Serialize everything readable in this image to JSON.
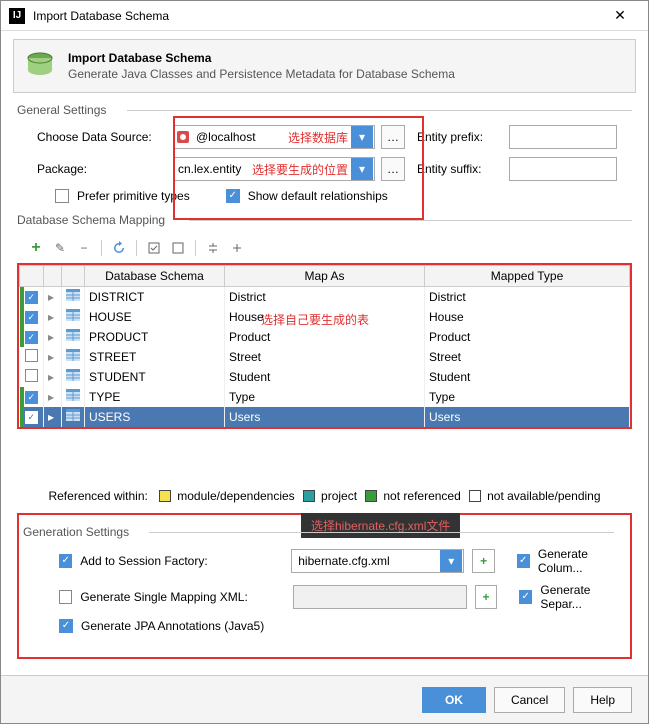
{
  "window": {
    "title": "Import Database Schema"
  },
  "banner": {
    "title": "Import Database Schema",
    "subtitle": "Generate Java Classes and Persistence Metadata for Database Schema"
  },
  "sections": {
    "general": "General Settings",
    "dbmap": "Database Schema Mapping",
    "gen": "Generation Settings"
  },
  "general": {
    "data_source_label": "Choose Data Source:",
    "data_source_value": "@localhost",
    "data_source_ann": "选择数据库",
    "package_label": "Package:",
    "package_value": "cn.lex.entity",
    "package_ann": "选择要生成的位置",
    "entity_prefix_label": "Entity prefix:",
    "entity_prefix_value": "",
    "entity_suffix_label": "Entity suffix:",
    "entity_suffix_value": "",
    "prefer_primitive": "Prefer primitive types",
    "show_default_rel": "Show default relationships"
  },
  "table": {
    "headers": {
      "schema": "Database Schema",
      "map": "Map As",
      "type": "Mapped Type"
    },
    "annotation": "选择自己要生成的表",
    "rows": [
      {
        "checked": true,
        "green": true,
        "name": "DISTRICT",
        "map": "District",
        "type": "District"
      },
      {
        "checked": true,
        "green": true,
        "name": "HOUSE",
        "map": "House",
        "type": "House"
      },
      {
        "checked": true,
        "green": true,
        "name": "PRODUCT",
        "map": "Product",
        "type": "Product"
      },
      {
        "checked": false,
        "green": false,
        "name": "STREET",
        "map": "Street",
        "type": "Street"
      },
      {
        "checked": false,
        "green": false,
        "name": "STUDENT",
        "map": "Student",
        "type": "Student"
      },
      {
        "checked": true,
        "green": true,
        "name": "TYPE",
        "map": "Type",
        "type": "Type"
      },
      {
        "checked": true,
        "green": true,
        "name": "USERS",
        "map": "Users",
        "type": "Users",
        "selected": true
      }
    ]
  },
  "legend": {
    "prefix": "Referenced within:",
    "items": [
      {
        "label": "module/dependencies",
        "color": "#f5e050"
      },
      {
        "label": "project",
        "color": "#2aa0a0"
      },
      {
        "label": "not referenced",
        "color": "#3a9c3a"
      },
      {
        "label": "not available/pending",
        "color": "#ffffff"
      }
    ]
  },
  "gen": {
    "overlay": "选择hibernate.cfg.xml文件",
    "session_label": "Add to Session Factory:",
    "session_value": "hibernate.cfg.xml",
    "single_mapping_label": "Generate Single Mapping XML:",
    "single_mapping_value": "",
    "jpa_label": "Generate JPA Annotations (Java5)",
    "gen_col": "Generate Colum...",
    "gen_sep": "Generate Separ..."
  },
  "footer": {
    "ok": "OK",
    "cancel": "Cancel",
    "help": "Help"
  }
}
